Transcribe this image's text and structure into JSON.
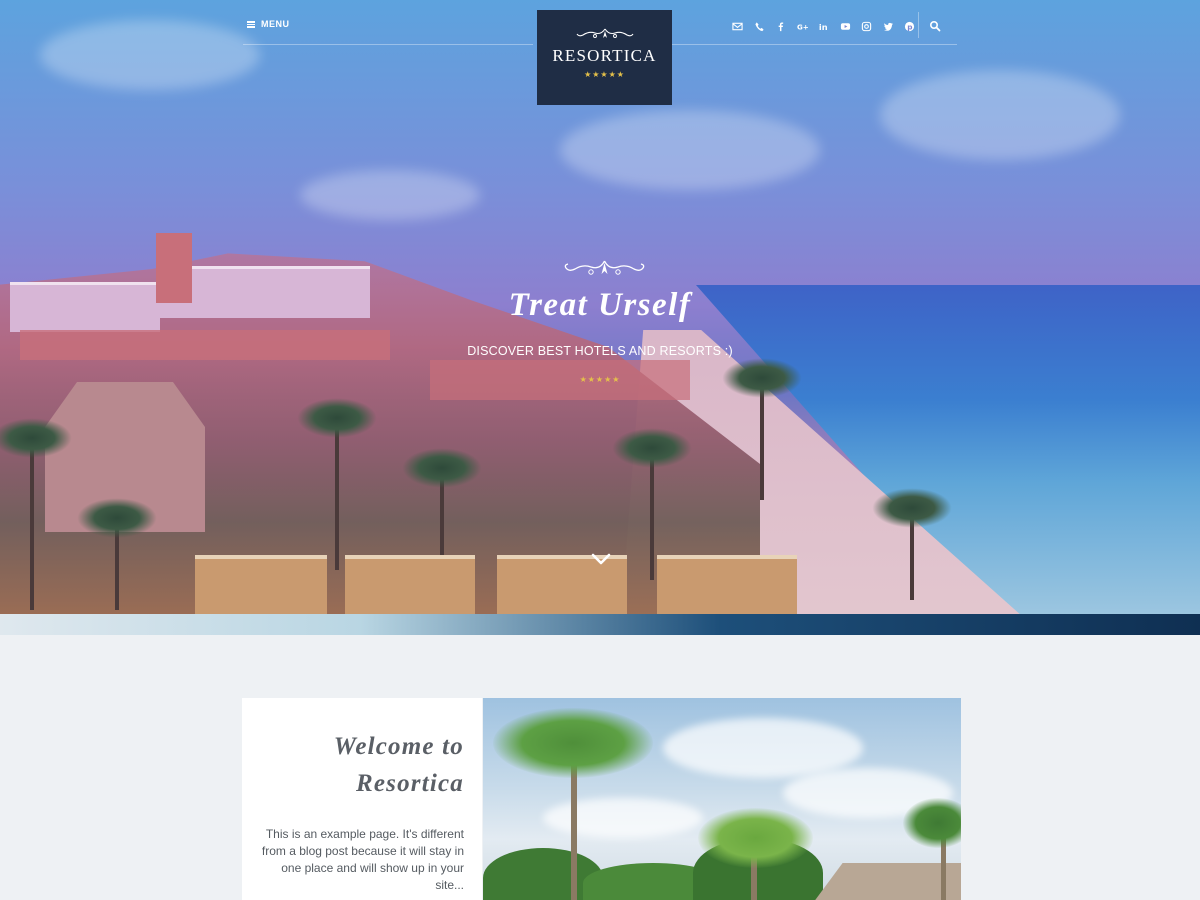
{
  "header": {
    "menu_label": "MENU",
    "social_icons": [
      "envelope-icon",
      "phone-icon",
      "facebook-icon",
      "google-plus-icon",
      "linkedin-icon",
      "youtube-icon",
      "instagram-icon",
      "twitter-icon",
      "pinterest-icon"
    ],
    "search_icon": "search-icon"
  },
  "logo": {
    "name": "RESORTICA",
    "stars": "★★★★★"
  },
  "hero": {
    "title": "Treat Urself",
    "subtitle": "DISCOVER BEST HOTELS AND RESORTS :)",
    "stars": "★★★★★",
    "scroll_icon": "chevron-down-icon"
  },
  "welcome": {
    "title_line1": "Welcome to",
    "title_line2": "Resortica",
    "text": "This is an example page. It's different from a blog post because it will stay in one place and will show up in your site..."
  },
  "colors": {
    "logo_bg": "#1f2d45",
    "star_gold": "#e5c14a",
    "page_bg": "#eef1f4"
  }
}
